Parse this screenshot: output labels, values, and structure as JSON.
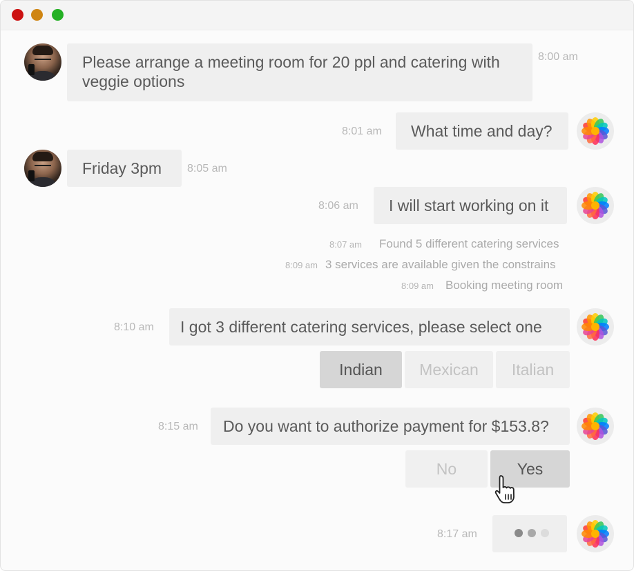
{
  "messages": {
    "m1": {
      "text": "Please arrange a meeting room for 20 ppl and catering with veggie options",
      "time": "8:00 am"
    },
    "m2": {
      "text": "What time and day?",
      "time": "8:01 am"
    },
    "m3": {
      "text": "Friday 3pm",
      "time": "8:05 am"
    },
    "m4": {
      "text": "I will start working on it",
      "time": "8:06 am"
    },
    "m5": {
      "text": "I got 3 different catering services, please select one",
      "time": "8:10 am"
    },
    "m6": {
      "text": "Do you want to authorize payment for $153.8?",
      "time": "8:15 am"
    },
    "m7": {
      "time": "8:17 am"
    }
  },
  "statuses": [
    {
      "time": "8:07 am",
      "text": "Found 5 different catering services"
    },
    {
      "time": "8:09 am",
      "text": "3 services are available given the constrains"
    },
    {
      "time": "8:09 am",
      "text": "Booking meeting room"
    }
  ],
  "catering_options": [
    {
      "label": "Indian",
      "selected": true
    },
    {
      "label": "Mexican",
      "selected": false
    },
    {
      "label": "Italian",
      "selected": false
    }
  ],
  "payment_options": [
    {
      "label": "No"
    },
    {
      "label": "Yes"
    }
  ],
  "colors": {
    "red": "#cc1212",
    "yellow": "#cf8512",
    "green": "#24b024",
    "bubble": "#efefef",
    "selected_option": "#d6d6d6"
  },
  "icons": {
    "user_avatar": "user-avatar",
    "bot_avatar": "bot-avatar-flower",
    "cursor": "hand-pointer-icon",
    "typing": "typing-indicator"
  }
}
